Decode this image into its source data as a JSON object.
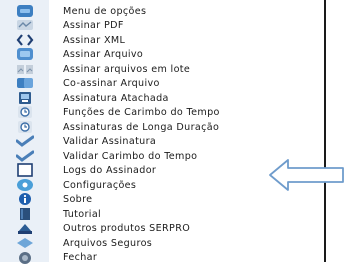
{
  "menu": {
    "items": [
      {
        "label": "Menu de opções",
        "icon": "menu-options-icon"
      },
      {
        "label": "Assinar PDF",
        "icon": "pdf-sign-icon"
      },
      {
        "label": "Assinar XML",
        "icon": "xml-code-icon"
      },
      {
        "label": "Assinar Arquivo",
        "icon": "file-sign-icon"
      },
      {
        "label": "Assinar arquivos em lote",
        "icon": "batch-files-icon"
      },
      {
        "label": "Co-assinar Arquivo",
        "icon": "co-sign-icon"
      },
      {
        "label": "Assinatura Atachada",
        "icon": "attached-signature-icon"
      },
      {
        "label": "Funções de Carimbo do Tempo",
        "icon": "timestamp-icon"
      },
      {
        "label": "Assinaturas de Longa Duração",
        "icon": "long-term-signature-icon"
      },
      {
        "label": "Validar Assinatura",
        "icon": "validate-check-icon"
      },
      {
        "label": "Validar Carimbo do Tempo",
        "icon": "validate-timestamp-icon"
      },
      {
        "label": "Logs do Assinador",
        "icon": "logs-icon"
      },
      {
        "label": "Configurações",
        "icon": "settings-icon"
      },
      {
        "label": "Sobre",
        "icon": "info-icon"
      },
      {
        "label": "Tutorial",
        "icon": "book-icon"
      },
      {
        "label": "Outros produtos SERPRO",
        "icon": "products-icon"
      },
      {
        "label": "Arquivos Seguros",
        "icon": "secure-files-icon"
      },
      {
        "label": "Fechar",
        "icon": "close-icon"
      }
    ]
  },
  "colors": {
    "icon_blue": "#3d7fc1",
    "icon_dark": "#1f3f73",
    "arrow_fill": "#ffffff",
    "arrow_stroke": "#6f9ccc"
  }
}
